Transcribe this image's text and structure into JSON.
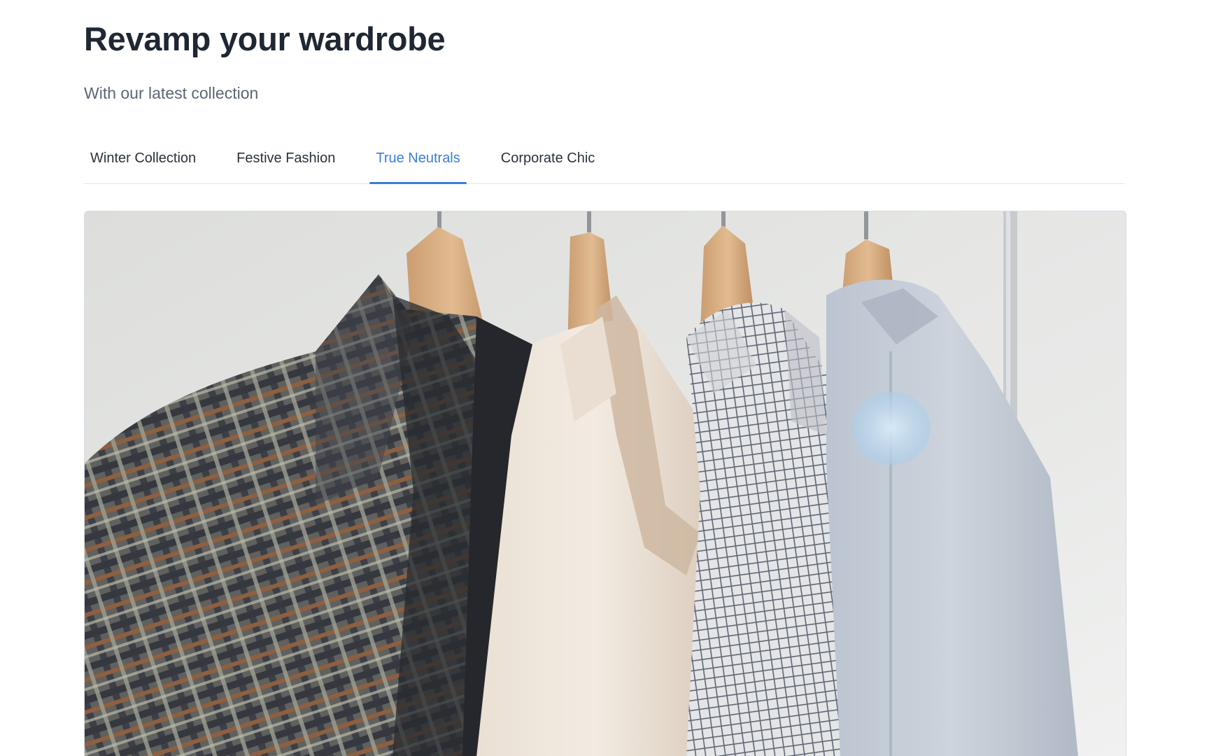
{
  "header": {
    "title": "Revamp your wardrobe",
    "subtitle": "With our latest collection"
  },
  "tabs": [
    {
      "label": "Winter Collection",
      "active": false
    },
    {
      "label": "Festive Fashion",
      "active": false
    },
    {
      "label": "True Neutrals",
      "active": true
    },
    {
      "label": "Corporate Chic",
      "active": false
    }
  ],
  "hero_image": {
    "subject": "shirts-on-hangers-photo"
  },
  "colors": {
    "accent": "#3b7ddd",
    "title": "#1f2733",
    "subtitle": "#5c6675",
    "divider": "#e2e6ea"
  }
}
